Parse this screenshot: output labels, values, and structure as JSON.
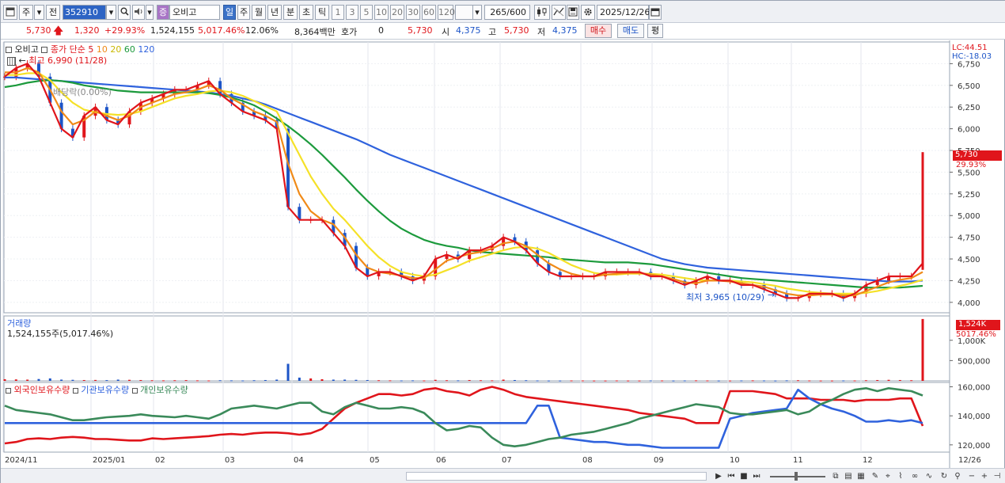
{
  "toolbar": {
    "period_label": "주",
    "prev_label": "전",
    "stock_code": "352910",
    "market_badge": "증",
    "stock_name": "오비고",
    "tabs": [
      "일",
      "주",
      "월",
      "년",
      "분",
      "초",
      "틱"
    ],
    "active_tab": "일",
    "numbers": [
      "1",
      "3",
      "5",
      "10",
      "20",
      "30",
      "60",
      "120"
    ],
    "count_value": "265",
    "count_total": "/600",
    "date": "2025/12/26"
  },
  "quote": {
    "price": "5,730",
    "change": "1,320",
    "change_pct": "+29.93%",
    "volume": "1,524,155",
    "volume_pct": "5,017.46%",
    "turnover_pct": "12.06%",
    "amount": "8,364백만",
    "hoga_label": "호가",
    "hoga_value": "0",
    "hoga_price": "5,730",
    "open_label": "시",
    "open_value": "4,375",
    "high_label": "고",
    "high_value": "5,730",
    "low_label": "저",
    "low_value": "4,375",
    "buy_button": "매수",
    "sell_button": "매도",
    "eval_button": "평"
  },
  "price_panel": {
    "title": "오비고",
    "ma_label": "종가 단순",
    "ma_periods": [
      "5",
      "10",
      "20",
      "60",
      "120"
    ],
    "ma_colors": [
      "#e0151b",
      "#f08a18",
      "#f5e128",
      "#1c9a3c",
      "#2f62dd"
    ],
    "high_marker": "최고 6,990 (11/28)",
    "low_marker": "최저 3,965 (10/29)",
    "faded_text": "배당락(0.00%)",
    "lc_label": "LC:44.51",
    "hc_label": "HC:-18.03",
    "price_tag": "5,730",
    "price_tag_pct": "29.93%"
  },
  "volume_panel": {
    "title": "거래량",
    "subtitle": "1,524,155주(5,017.46%)",
    "tag": "1,524K",
    "tag_pct": "5017.46%"
  },
  "holding_panel": {
    "legend": [
      {
        "label": "외국인보유수량",
        "color": "#e0151b"
      },
      {
        "label": "기관보유수량",
        "color": "#2f62dd"
      },
      {
        "label": "개인보유수량",
        "color": "#3a8a5a"
      }
    ]
  },
  "x_axis_labels": [
    "2024/11",
    "2025/01",
    "02",
    "03",
    "04",
    "05",
    "06",
    "07",
    "08",
    "09",
    "10",
    "11",
    "12",
    "12/26"
  ],
  "chart_data": [
    {
      "type": "line",
      "panel": "price",
      "y_ticks": [
        "6,750",
        "6,500",
        "6,250",
        "6,000",
        "5,750",
        "5,500",
        "5,250",
        "5,000",
        "4,750",
        "4,500",
        "4,250",
        "4,000"
      ],
      "ylim": [
        3880,
        7000
      ],
      "series": [
        {
          "name": "5",
          "color": "#e0151b",
          "values": [
            6600,
            6700,
            6750,
            6600,
            6300,
            6000,
            5900,
            6150,
            6250,
            6100,
            6050,
            6200,
            6300,
            6350,
            6400,
            6450,
            6450,
            6500,
            6550,
            6400,
            6300,
            6200,
            6150,
            6100,
            6000,
            5100,
            4950,
            4950,
            4950,
            4800,
            4650,
            4400,
            4300,
            4350,
            4350,
            4300,
            4250,
            4300,
            4500,
            4550,
            4500,
            4600,
            4600,
            4650,
            4750,
            4700,
            4600,
            4450,
            4350,
            4300,
            4300,
            4300,
            4300,
            4350,
            4350,
            4350,
            4350,
            4300,
            4300,
            4250,
            4200,
            4250,
            4300,
            4250,
            4250,
            4200,
            4200,
            4150,
            4100,
            4050,
            4050,
            4100,
            4100,
            4100,
            4050,
            4100,
            4200,
            4250,
            4300,
            4300,
            4300,
            4450
          ]
        },
        {
          "name": "10",
          "color": "#f08a18",
          "values": [
            6650,
            6650,
            6700,
            6650,
            6450,
            6200,
            6050,
            6100,
            6200,
            6150,
            6100,
            6150,
            6250,
            6300,
            6350,
            6400,
            6420,
            6450,
            6500,
            6450,
            6350,
            6280,
            6200,
            6150,
            6080,
            5600,
            5250,
            5050,
            4950,
            4900,
            4750,
            4550,
            4400,
            4350,
            4330,
            4310,
            4280,
            4280,
            4380,
            4480,
            4520,
            4560,
            4580,
            4620,
            4680,
            4700,
            4650,
            4550,
            4450,
            4380,
            4330,
            4300,
            4300,
            4320,
            4330,
            4340,
            4340,
            4320,
            4300,
            4270,
            4230,
            4220,
            4250,
            4250,
            4240,
            4220,
            4200,
            4180,
            4140,
            4100,
            4080,
            4080,
            4090,
            4090,
            4080,
            4080,
            4130,
            4180,
            4230,
            4260,
            4280,
            4350
          ]
        },
        {
          "name": "20",
          "color": "#f5e128",
          "values": [
            6620,
            6620,
            6640,
            6640,
            6560,
            6420,
            6300,
            6220,
            6190,
            6170,
            6160,
            6170,
            6200,
            6250,
            6300,
            6350,
            6380,
            6400,
            6430,
            6440,
            6420,
            6380,
            6320,
            6260,
            6200,
            5950,
            5700,
            5450,
            5250,
            5080,
            4950,
            4800,
            4650,
            4520,
            4420,
            4350,
            4320,
            4300,
            4320,
            4370,
            4420,
            4480,
            4520,
            4560,
            4600,
            4630,
            4640,
            4620,
            4570,
            4500,
            4430,
            4380,
            4340,
            4320,
            4320,
            4330,
            4330,
            4330,
            4320,
            4300,
            4280,
            4260,
            4250,
            4250,
            4250,
            4240,
            4230,
            4210,
            4190,
            4160,
            4140,
            4120,
            4110,
            4100,
            4100,
            4100,
            4110,
            4130,
            4160,
            4190,
            4220,
            4260
          ]
        },
        {
          "name": "60",
          "color": "#1c9a3c",
          "values": [
            6480,
            6500,
            6530,
            6550,
            6560,
            6550,
            6530,
            6500,
            6480,
            6460,
            6440,
            6430,
            6420,
            6420,
            6420,
            6420,
            6420,
            6420,
            6410,
            6390,
            6360,
            6320,
            6270,
            6200,
            6120,
            6030,
            5930,
            5820,
            5700,
            5570,
            5440,
            5300,
            5170,
            5050,
            4940,
            4850,
            4780,
            4720,
            4680,
            4650,
            4630,
            4600,
            4580,
            4570,
            4560,
            4550,
            4540,
            4530,
            4520,
            4500,
            4490,
            4480,
            4470,
            4460,
            4460,
            4460,
            4450,
            4440,
            4420,
            4400,
            4380,
            4360,
            4340,
            4320,
            4300,
            4280,
            4270,
            4260,
            4250,
            4240,
            4230,
            4220,
            4210,
            4200,
            4190,
            4180,
            4170,
            4170,
            4170,
            4170,
            4180,
            4190
          ]
        },
        {
          "name": "120",
          "color": "#2f62dd",
          "values": [
            6590,
            6590,
            6580,
            6570,
            6560,
            6550,
            6540,
            6530,
            6520,
            6510,
            6500,
            6490,
            6480,
            6470,
            6460,
            6450,
            6440,
            6430,
            6420,
            6400,
            6380,
            6350,
            6320,
            6280,
            6230,
            6180,
            6130,
            6080,
            6030,
            5980,
            5930,
            5880,
            5820,
            5760,
            5700,
            5650,
            5600,
            5550,
            5500,
            5450,
            5400,
            5350,
            5300,
            5250,
            5200,
            5150,
            5100,
            5050,
            5000,
            4950,
            4900,
            4850,
            4800,
            4750,
            4700,
            4650,
            4600,
            4550,
            4500,
            4470,
            4440,
            4420,
            4400,
            4390,
            4380,
            4370,
            4360,
            4350,
            4340,
            4330,
            4320,
            4310,
            4300,
            4290,
            4280,
            4270,
            4260,
            4250,
            4240,
            4240,
            4240,
            4250
          ]
        }
      ],
      "last_bar": {
        "open": 4375,
        "high": 5730,
        "low": 4375,
        "close": 5730
      }
    },
    {
      "type": "bar",
      "panel": "volume",
      "y_ticks": [
        "1,000K",
        "500,000"
      ],
      "ylim": [
        0,
        1600000
      ],
      "values": [
        40000,
        35000,
        30000,
        45000,
        60000,
        30000,
        25000,
        20000,
        22000,
        18000,
        30000,
        25000,
        20000,
        15000,
        12000,
        15000,
        18000,
        12000,
        10000,
        15000,
        12000,
        10000,
        15000,
        20000,
        30000,
        420000,
        80000,
        60000,
        40000,
        30000,
        30000,
        25000,
        20000,
        15000,
        12000,
        10000,
        12000,
        10000,
        25000,
        15000,
        12000,
        20000,
        15000,
        12000,
        30000,
        20000,
        15000,
        10000,
        8000,
        8000,
        10000,
        10000,
        8000,
        8000,
        10000,
        8000,
        8000,
        10000,
        10000,
        8000,
        10000,
        12000,
        10000,
        8000,
        8000,
        10000,
        12000,
        10000,
        8000,
        12000,
        15000,
        10000,
        8000,
        8000,
        10000,
        10000,
        15000,
        20000,
        25000,
        20000,
        15000,
        1524155
      ]
    },
    {
      "type": "line",
      "panel": "holding",
      "y_ticks": [
        "160,000",
        "140,000",
        "120,000"
      ],
      "ylim": [
        115000,
        163000
      ],
      "series": [
        {
          "name": "외국인보유수량",
          "color": "#e0151b",
          "values": [
            121000,
            122000,
            124000,
            124500,
            124000,
            125000,
            125500,
            125000,
            124000,
            124000,
            123500,
            123000,
            123000,
            124500,
            124000,
            124500,
            125000,
            125500,
            126000,
            127000,
            127500,
            127000,
            128000,
            128500,
            128500,
            128000,
            127000,
            128000,
            131000,
            138000,
            145000,
            149000,
            152000,
            155000,
            155000,
            154000,
            155000,
            158000,
            159000,
            157000,
            156000,
            154000,
            158000,
            160000,
            158000,
            155000,
            153000,
            152000,
            151000,
            150000,
            149000,
            148000,
            147000,
            146000,
            145000,
            144000,
            142000,
            141000,
            140000,
            139000,
            138000,
            135000,
            135000,
            135000,
            157000,
            157000,
            157000,
            156000,
            155000,
            152000,
            152000,
            152000,
            151000,
            151000,
            151000,
            150000,
            151000,
            151000,
            151000,
            152000,
            152000,
            133000
          ]
        },
        {
          "name": "기관보유수량",
          "color": "#2f62dd",
          "values": [
            135000,
            135000,
            135000,
            135000,
            135000,
            135000,
            135000,
            135000,
            135000,
            135000,
            135000,
            135000,
            135000,
            135000,
            135000,
            135000,
            135000,
            135000,
            135000,
            135000,
            135000,
            135000,
            135000,
            135000,
            135000,
            135000,
            135000,
            135000,
            135000,
            135000,
            135000,
            135000,
            135000,
            135000,
            135000,
            135000,
            135000,
            135000,
            135000,
            135000,
            135000,
            135000,
            135000,
            135000,
            135000,
            135000,
            135000,
            147000,
            147000,
            125000,
            124000,
            123000,
            122000,
            122000,
            121000,
            120000,
            120000,
            119000,
            118000,
            118000,
            118000,
            118000,
            118000,
            118000,
            138000,
            140000,
            142000,
            143000,
            144000,
            145000,
            158000,
            152000,
            148000,
            145000,
            143000,
            140000,
            136000,
            136000,
            137000,
            136000,
            137000,
            135000
          ]
        },
        {
          "name": "개인보유수량",
          "color": "#3a8a5a",
          "values": [
            147000,
            144000,
            143000,
            142000,
            141000,
            139000,
            137000,
            137000,
            138000,
            139000,
            139500,
            140000,
            141000,
            140000,
            139500,
            139000,
            140000,
            139000,
            138000,
            141000,
            145000,
            146000,
            147000,
            146000,
            145000,
            147000,
            149000,
            149000,
            143000,
            141000,
            146000,
            149000,
            147000,
            145000,
            145000,
            146000,
            145000,
            142000,
            135000,
            130000,
            131000,
            133000,
            132000,
            125000,
            120000,
            119000,
            120000,
            122000,
            124000,
            125000,
            127000,
            128000,
            129000,
            131000,
            133000,
            135000,
            138000,
            140000,
            142000,
            144000,
            146000,
            148000,
            147000,
            146000,
            142000,
            141000,
            141000,
            142000,
            143000,
            144000,
            141000,
            143000,
            148000,
            151000,
            155000,
            158000,
            159000,
            157000,
            159000,
            158000,
            157000,
            154000
          ]
        }
      ]
    }
  ]
}
